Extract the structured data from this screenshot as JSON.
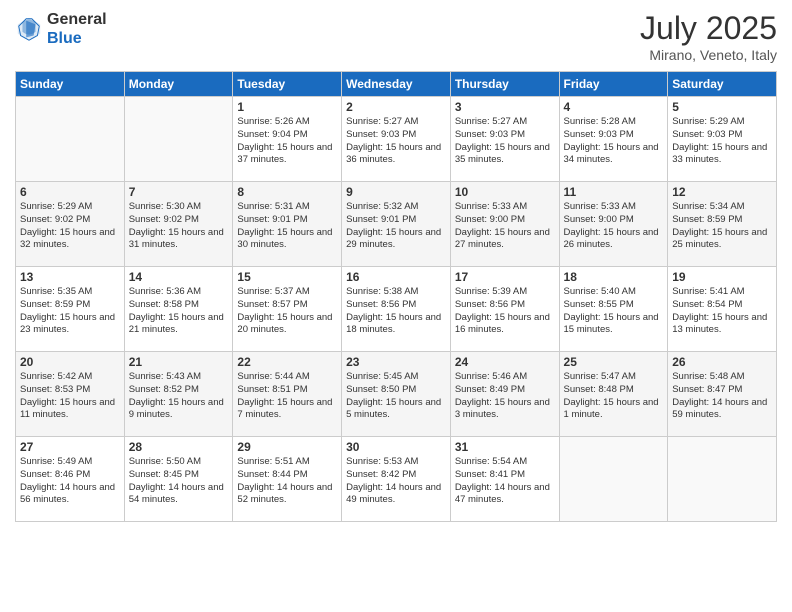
{
  "header": {
    "logo_general": "General",
    "logo_blue": "Blue",
    "month_year": "July 2025",
    "location": "Mirano, Veneto, Italy"
  },
  "days_of_week": [
    "Sunday",
    "Monday",
    "Tuesday",
    "Wednesday",
    "Thursday",
    "Friday",
    "Saturday"
  ],
  "weeks": [
    [
      {
        "day": "",
        "info": ""
      },
      {
        "day": "",
        "info": ""
      },
      {
        "day": "1",
        "info": "Sunrise: 5:26 AM\nSunset: 9:04 PM\nDaylight: 15 hours and 37 minutes."
      },
      {
        "day": "2",
        "info": "Sunrise: 5:27 AM\nSunset: 9:03 PM\nDaylight: 15 hours and 36 minutes."
      },
      {
        "day": "3",
        "info": "Sunrise: 5:27 AM\nSunset: 9:03 PM\nDaylight: 15 hours and 35 minutes."
      },
      {
        "day": "4",
        "info": "Sunrise: 5:28 AM\nSunset: 9:03 PM\nDaylight: 15 hours and 34 minutes."
      },
      {
        "day": "5",
        "info": "Sunrise: 5:29 AM\nSunset: 9:03 PM\nDaylight: 15 hours and 33 minutes."
      }
    ],
    [
      {
        "day": "6",
        "info": "Sunrise: 5:29 AM\nSunset: 9:02 PM\nDaylight: 15 hours and 32 minutes."
      },
      {
        "day": "7",
        "info": "Sunrise: 5:30 AM\nSunset: 9:02 PM\nDaylight: 15 hours and 31 minutes."
      },
      {
        "day": "8",
        "info": "Sunrise: 5:31 AM\nSunset: 9:01 PM\nDaylight: 15 hours and 30 minutes."
      },
      {
        "day": "9",
        "info": "Sunrise: 5:32 AM\nSunset: 9:01 PM\nDaylight: 15 hours and 29 minutes."
      },
      {
        "day": "10",
        "info": "Sunrise: 5:33 AM\nSunset: 9:00 PM\nDaylight: 15 hours and 27 minutes."
      },
      {
        "day": "11",
        "info": "Sunrise: 5:33 AM\nSunset: 9:00 PM\nDaylight: 15 hours and 26 minutes."
      },
      {
        "day": "12",
        "info": "Sunrise: 5:34 AM\nSunset: 8:59 PM\nDaylight: 15 hours and 25 minutes."
      }
    ],
    [
      {
        "day": "13",
        "info": "Sunrise: 5:35 AM\nSunset: 8:59 PM\nDaylight: 15 hours and 23 minutes."
      },
      {
        "day": "14",
        "info": "Sunrise: 5:36 AM\nSunset: 8:58 PM\nDaylight: 15 hours and 21 minutes."
      },
      {
        "day": "15",
        "info": "Sunrise: 5:37 AM\nSunset: 8:57 PM\nDaylight: 15 hours and 20 minutes."
      },
      {
        "day": "16",
        "info": "Sunrise: 5:38 AM\nSunset: 8:56 PM\nDaylight: 15 hours and 18 minutes."
      },
      {
        "day": "17",
        "info": "Sunrise: 5:39 AM\nSunset: 8:56 PM\nDaylight: 15 hours and 16 minutes."
      },
      {
        "day": "18",
        "info": "Sunrise: 5:40 AM\nSunset: 8:55 PM\nDaylight: 15 hours and 15 minutes."
      },
      {
        "day": "19",
        "info": "Sunrise: 5:41 AM\nSunset: 8:54 PM\nDaylight: 15 hours and 13 minutes."
      }
    ],
    [
      {
        "day": "20",
        "info": "Sunrise: 5:42 AM\nSunset: 8:53 PM\nDaylight: 15 hours and 11 minutes."
      },
      {
        "day": "21",
        "info": "Sunrise: 5:43 AM\nSunset: 8:52 PM\nDaylight: 15 hours and 9 minutes."
      },
      {
        "day": "22",
        "info": "Sunrise: 5:44 AM\nSunset: 8:51 PM\nDaylight: 15 hours and 7 minutes."
      },
      {
        "day": "23",
        "info": "Sunrise: 5:45 AM\nSunset: 8:50 PM\nDaylight: 15 hours and 5 minutes."
      },
      {
        "day": "24",
        "info": "Sunrise: 5:46 AM\nSunset: 8:49 PM\nDaylight: 15 hours and 3 minutes."
      },
      {
        "day": "25",
        "info": "Sunrise: 5:47 AM\nSunset: 8:48 PM\nDaylight: 15 hours and 1 minute."
      },
      {
        "day": "26",
        "info": "Sunrise: 5:48 AM\nSunset: 8:47 PM\nDaylight: 14 hours and 59 minutes."
      }
    ],
    [
      {
        "day": "27",
        "info": "Sunrise: 5:49 AM\nSunset: 8:46 PM\nDaylight: 14 hours and 56 minutes."
      },
      {
        "day": "28",
        "info": "Sunrise: 5:50 AM\nSunset: 8:45 PM\nDaylight: 14 hours and 54 minutes."
      },
      {
        "day": "29",
        "info": "Sunrise: 5:51 AM\nSunset: 8:44 PM\nDaylight: 14 hours and 52 minutes."
      },
      {
        "day": "30",
        "info": "Sunrise: 5:53 AM\nSunset: 8:42 PM\nDaylight: 14 hours and 49 minutes."
      },
      {
        "day": "31",
        "info": "Sunrise: 5:54 AM\nSunset: 8:41 PM\nDaylight: 14 hours and 47 minutes."
      },
      {
        "day": "",
        "info": ""
      },
      {
        "day": "",
        "info": ""
      }
    ]
  ]
}
